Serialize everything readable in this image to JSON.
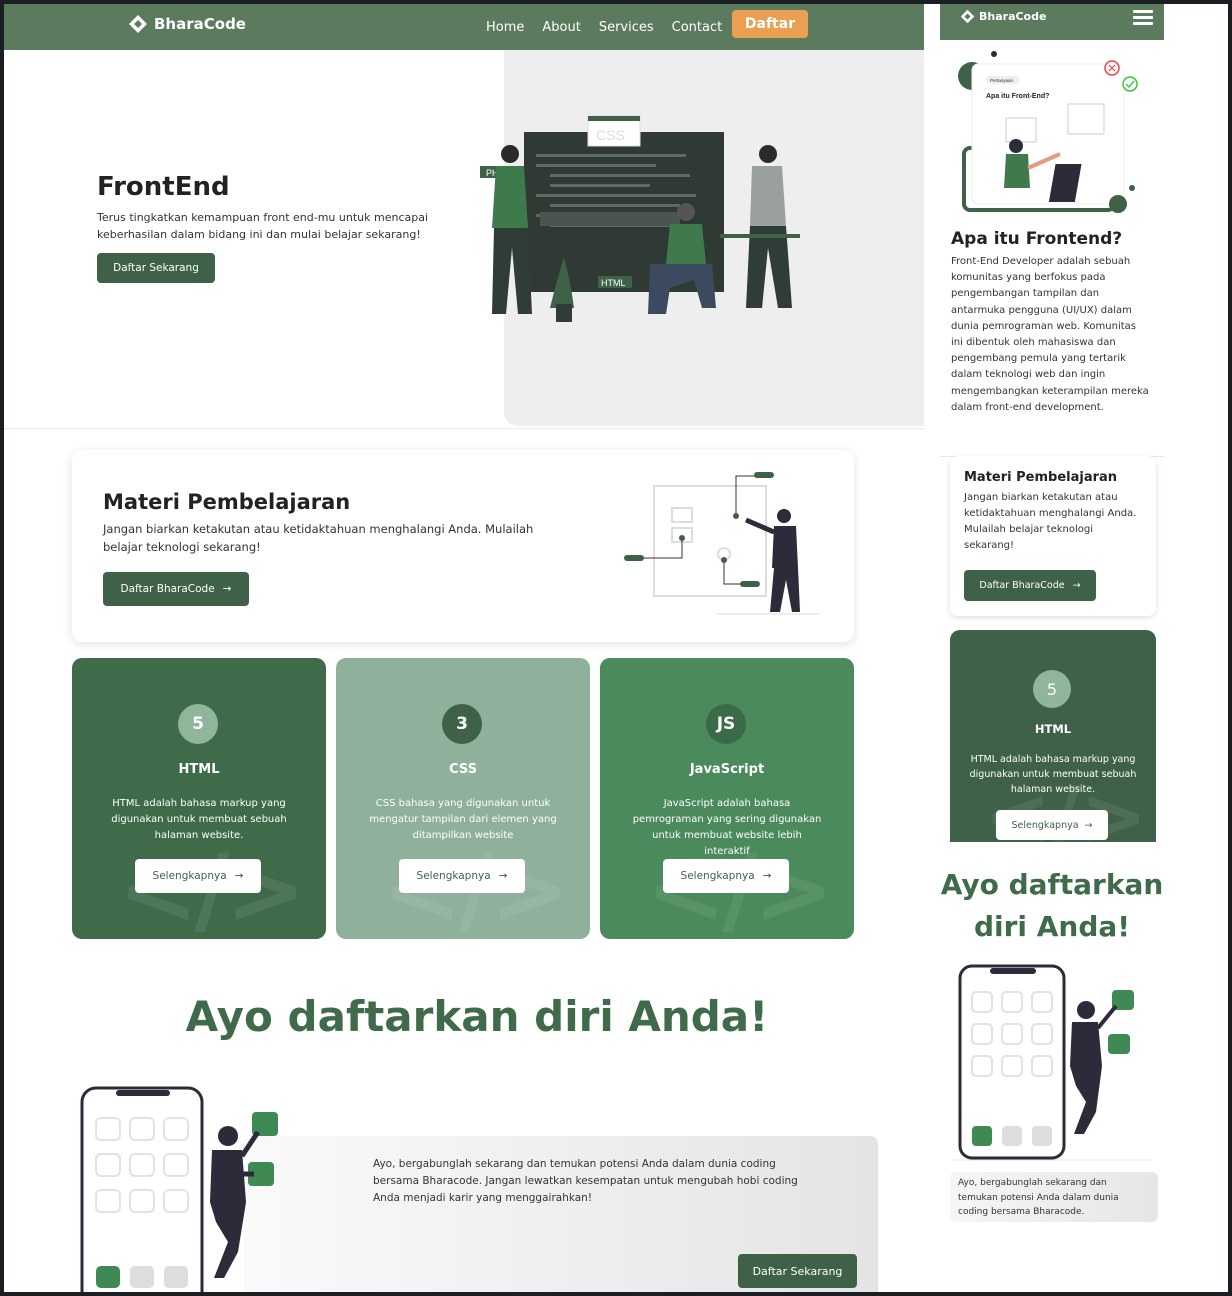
{
  "brand": {
    "name": "BharaCode",
    "primary": "#3f6147",
    "nav_bg": "#5b7a5e",
    "accent": "#e9a052"
  },
  "nav": {
    "links": [
      "Home",
      "About",
      "Services",
      "Contact"
    ],
    "cta": "Daftar"
  },
  "hero": {
    "title": "FrontEnd",
    "description": "Terus tingkatkan kemampuan front end-mu untuk mencapai keberhasilan dalam bidang ini dan mulai belajar sekarang!",
    "button": "Daftar Sekarang",
    "illustration_labels": [
      "CSS",
      "PHP",
      "HTML"
    ]
  },
  "materi": {
    "title": "Materi Pembelajaran",
    "description": "Jangan biarkan ketakutan atau ketidaktahuan menghalangi Anda. Mulailah belajar teknologi sekarang!",
    "button": "Daftar BharaCode"
  },
  "cards": [
    {
      "title": "HTML",
      "icon": "html5-icon",
      "glyph": "5",
      "description": "HTML adalah bahasa markup yang digunakan untuk membuat sebuah halaman website.",
      "button": "Selengkapnya",
      "bg": "#3f6b4a",
      "icon_bg": "#8fb59a"
    },
    {
      "title": "CSS",
      "icon": "css3-icon",
      "glyph": "3",
      "description": "CSS bahasa yang digunakan untuk mengatur tampilan dari elemen yang ditampilkan website",
      "button": "Selengkapnya",
      "bg": "#8fb09a",
      "icon_bg": "#3f6147"
    },
    {
      "title": "JavaScript",
      "icon": "js-icon",
      "glyph": "JS",
      "description": "JavaScript adalah bahasa pemrograman yang sering digunakan untuk membuat website lebih interaktif",
      "button": "Selengkapnya",
      "bg": "#4a8a5c",
      "icon_bg": "#3a6a48"
    }
  ],
  "cta": {
    "title": "Ayo daftarkan diri Anda!",
    "description": "Ayo, bergabunglah sekarang dan temukan potensi Anda dalam dunia coding bersama Bharacode. Jangan lewatkan kesempatan untuk mengubah hobi coding Anda menjadi karir yang menggairahkan!",
    "button": "Daftar Sekarang"
  },
  "mobile": {
    "illustration_tag": "Pertanyaan",
    "illustration_question": "Apa itu Front-End?",
    "about_title": "Apa itu Frontend?",
    "about_text": "Front-End Developer adalah sebuah komunitas yang berfokus pada pengembangan tampilan dan antarmuka pengguna (UI/UX) dalam dunia pemrograman web. Komunitas ini dibentuk oleh mahasiswa dan pengembang pemula yang tertarik dalam teknologi web dan ingin mengembangkan keterampilan mereka dalam front-end development.",
    "materi_title": "Materi Pembelajaran",
    "materi_text": "Jangan biarkan ketakutan atau ketidaktahuan menghalangi Anda. Mulailah belajar teknologi sekarang!",
    "materi_button": "Daftar BharaCode",
    "card_title": "HTML",
    "card_text": "HTML adalah bahasa markup yang digunakan untuk membuat sebuah halaman website.",
    "card_button": "Selengkapnya",
    "cta_title": "Ayo daftarkan diri Anda!",
    "cta_text": "Ayo, bergabunglah sekarang dan temukan potensi Anda dalam dunia coding bersama Bharacode."
  }
}
